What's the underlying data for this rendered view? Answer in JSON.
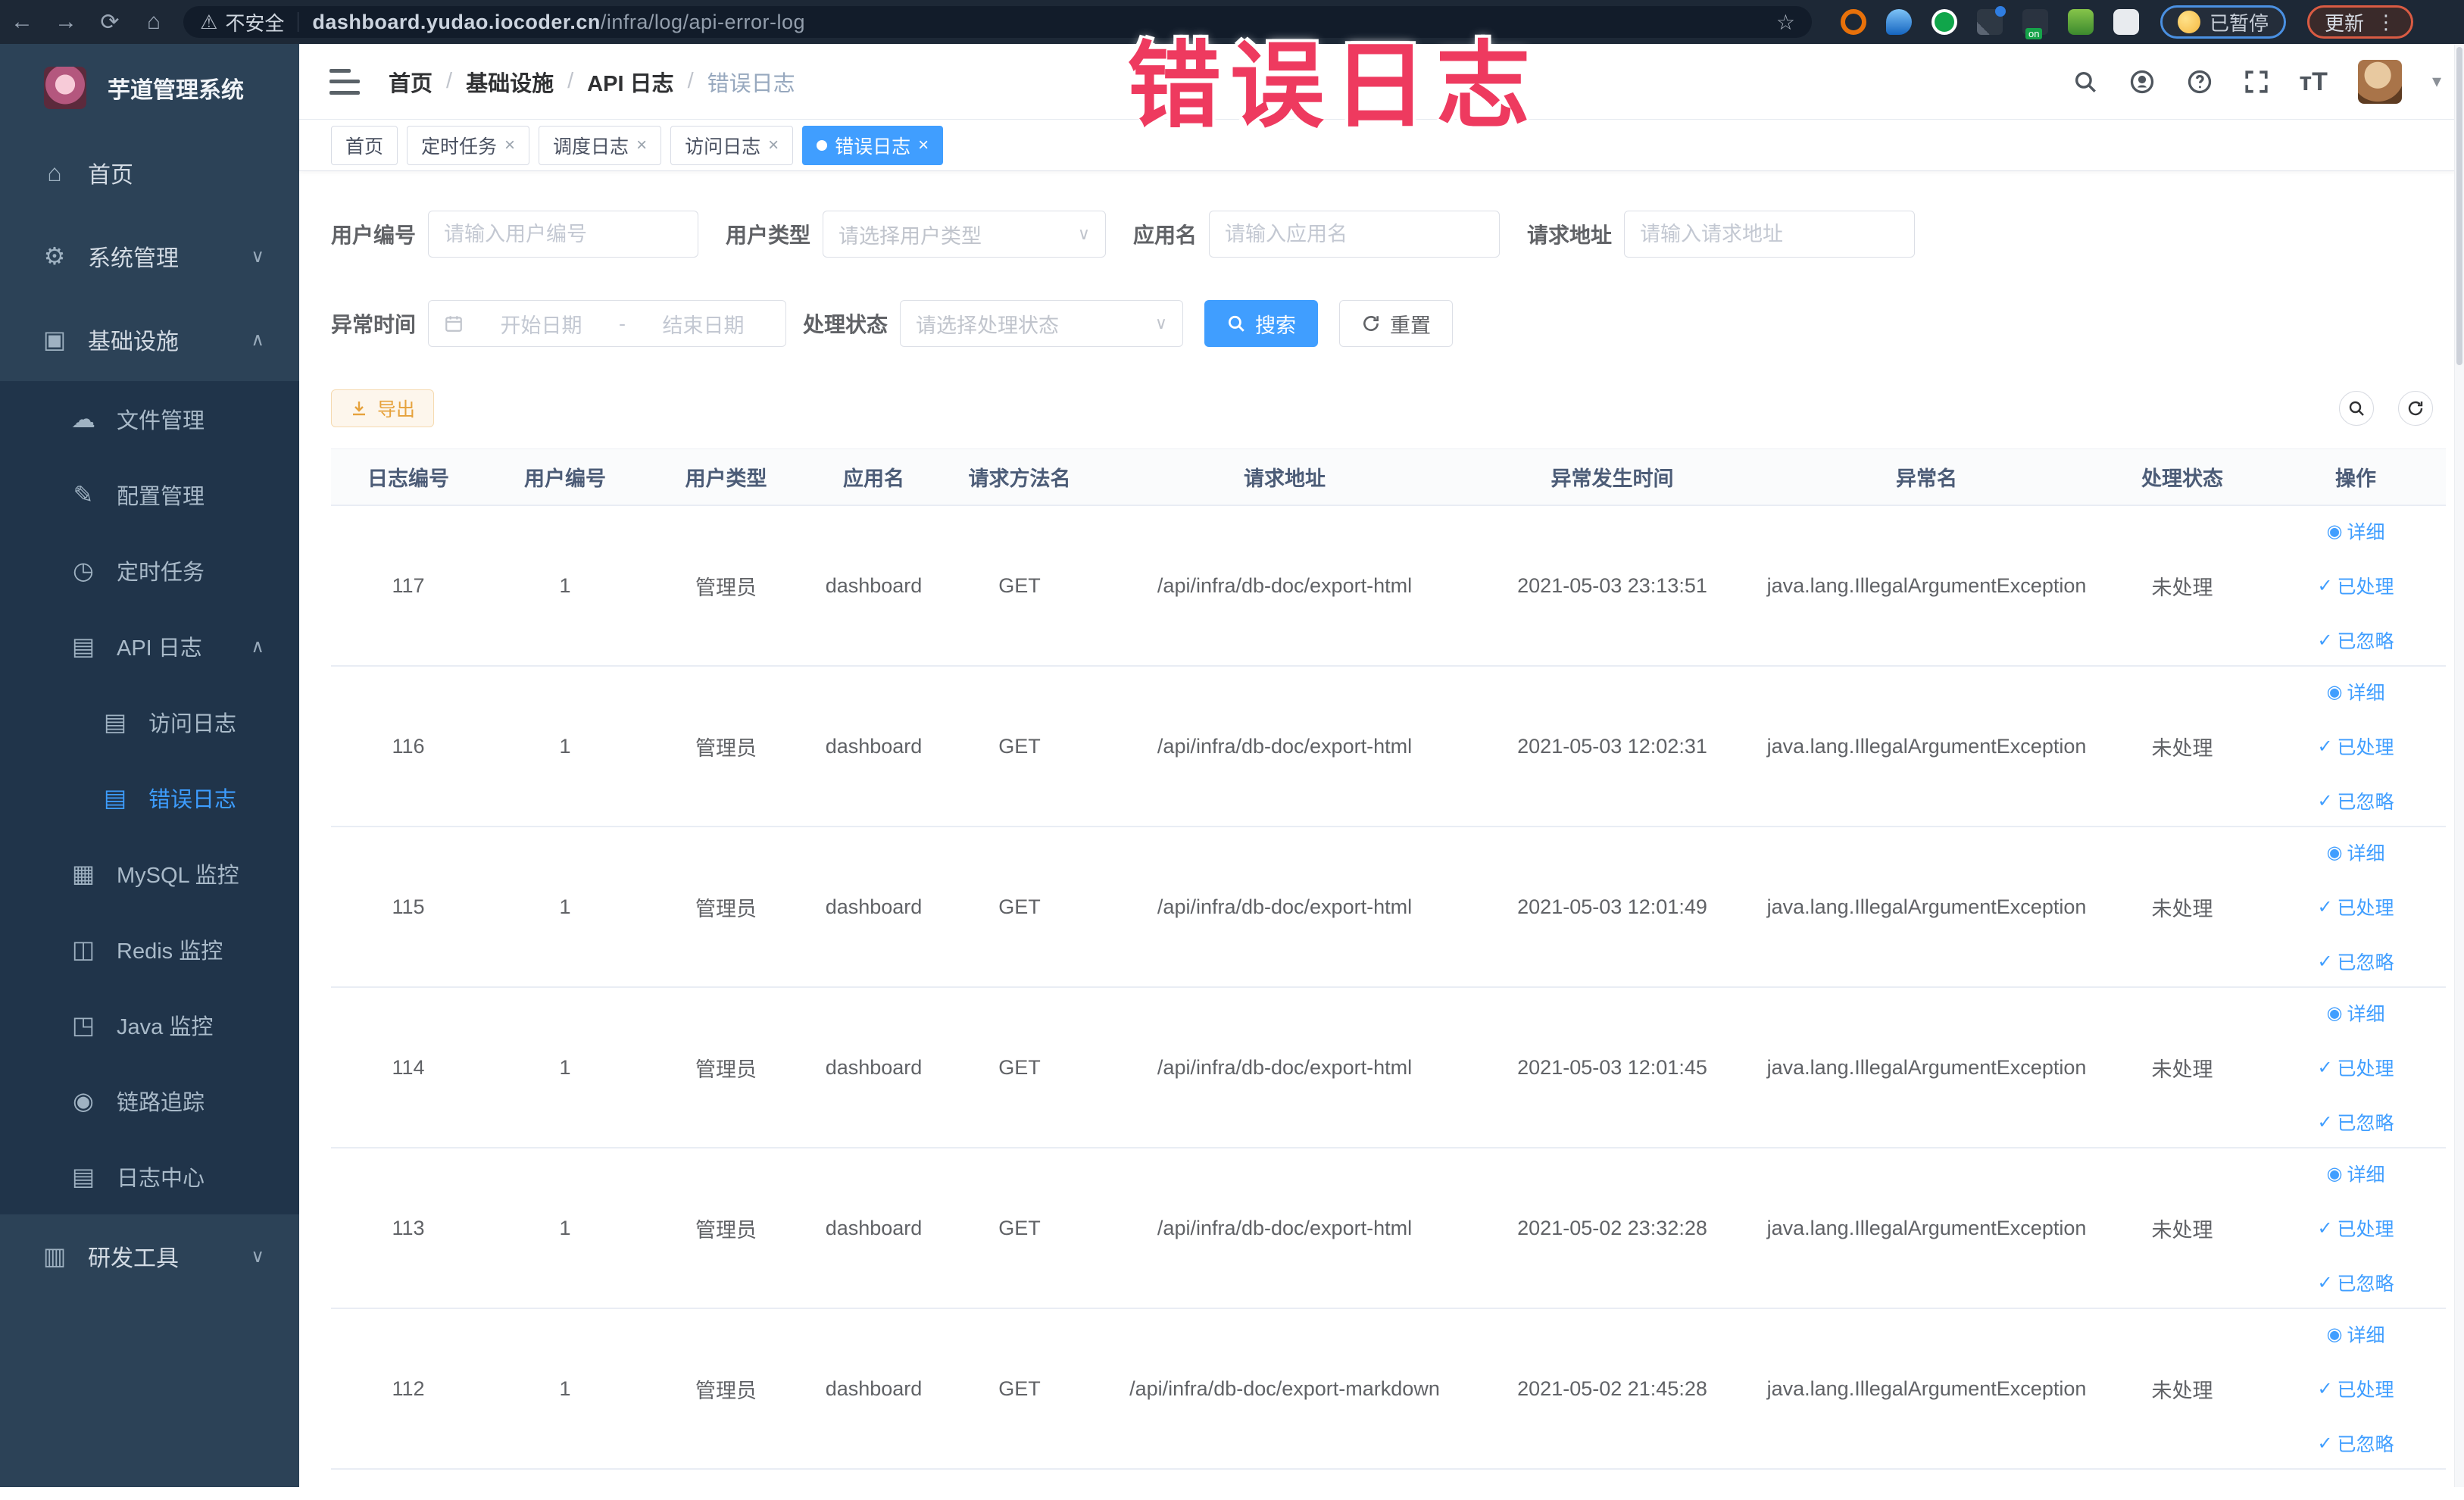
{
  "browser": {
    "security_label": "不安全",
    "url_domain": "dashboard.yudao.iocoder.cn",
    "url_path": "/infra/log/api-error-log",
    "paused_badge": "已暂停",
    "update_button": "更新"
  },
  "overlay": {
    "annotation": "错误日志",
    "color": "#ee3a5f"
  },
  "sidebar": {
    "title": "芋道管理系统",
    "items": [
      {
        "label": "首页",
        "icon": "home-icon",
        "level": 1
      },
      {
        "label": "系统管理",
        "icon": "gear-icon",
        "level": 1,
        "chevron": "down"
      },
      {
        "label": "基础设施",
        "icon": "monitor-icon",
        "level": 1,
        "chevron": "up"
      },
      {
        "label": "文件管理",
        "icon": "file-cloud-icon",
        "level": 2
      },
      {
        "label": "配置管理",
        "icon": "config-edit-icon",
        "level": 2
      },
      {
        "label": "定时任务",
        "icon": "schedule-icon",
        "level": 2
      },
      {
        "label": "API 日志",
        "icon": "api-log-icon",
        "level": 2,
        "chevron": "up"
      },
      {
        "label": "访问日志",
        "icon": "access-log-icon",
        "level": 3
      },
      {
        "label": "错误日志",
        "icon": "error-log-icon",
        "level": 3,
        "active": true
      },
      {
        "label": "MySQL 监控",
        "icon": "mysql-icon",
        "level": 2
      },
      {
        "label": "Redis 监控",
        "icon": "redis-icon",
        "level": 2
      },
      {
        "label": "Java 监控",
        "icon": "java-icon",
        "level": 2
      },
      {
        "label": "链路追踪",
        "icon": "trace-eye-icon",
        "level": 2
      },
      {
        "label": "日志中心",
        "icon": "log-center-icon",
        "level": 2
      },
      {
        "label": "研发工具",
        "icon": "tools-icon",
        "level": 1,
        "chevron": "down"
      }
    ]
  },
  "header": {
    "breadcrumb": [
      "首页",
      "基础设施",
      "API 日志",
      "错误日志"
    ]
  },
  "tags": [
    {
      "label": "首页"
    },
    {
      "label": "定时任务",
      "closable": true
    },
    {
      "label": "调度日志",
      "closable": true
    },
    {
      "label": "访问日志",
      "closable": true
    },
    {
      "label": "错误日志",
      "closable": true,
      "active": true
    }
  ],
  "filters": {
    "user_id": {
      "label": "用户编号",
      "placeholder": "请输入用户编号"
    },
    "user_type": {
      "label": "用户类型",
      "placeholder": "请选择用户类型"
    },
    "app_name": {
      "label": "应用名",
      "placeholder": "请输入应用名"
    },
    "request_url": {
      "label": "请求地址",
      "placeholder": "请输入请求地址"
    },
    "exception_time": {
      "label": "异常时间",
      "start_placeholder": "开始日期",
      "separator": "-",
      "end_placeholder": "结束日期"
    },
    "process_status": {
      "label": "处理状态",
      "placeholder": "请选择处理状态"
    },
    "search_button": "搜索",
    "reset_button": "重置"
  },
  "toolbar": {
    "export_button": "导出"
  },
  "table": {
    "columns": [
      "日志编号",
      "用户编号",
      "用户类型",
      "应用名",
      "请求方法名",
      "请求地址",
      "异常发生时间",
      "异常名",
      "处理状态",
      "操作"
    ],
    "actions": [
      "详细",
      "已处理",
      "已忽略"
    ],
    "rows": [
      {
        "id": "117",
        "user_id": "1",
        "user_type": "管理员",
        "app": "dashboard",
        "method": "GET",
        "url": "/api/infra/db-doc/export-html",
        "time": "2021-05-03 23:13:51",
        "exception": "java.lang.IllegalArgumentException",
        "status": "未处理"
      },
      {
        "id": "116",
        "user_id": "1",
        "user_type": "管理员",
        "app": "dashboard",
        "method": "GET",
        "url": "/api/infra/db-doc/export-html",
        "time": "2021-05-03 12:02:31",
        "exception": "java.lang.IllegalArgumentException",
        "status": "未处理"
      },
      {
        "id": "115",
        "user_id": "1",
        "user_type": "管理员",
        "app": "dashboard",
        "method": "GET",
        "url": "/api/infra/db-doc/export-html",
        "time": "2021-05-03 12:01:49",
        "exception": "java.lang.IllegalArgumentException",
        "status": "未处理"
      },
      {
        "id": "114",
        "user_id": "1",
        "user_type": "管理员",
        "app": "dashboard",
        "method": "GET",
        "url": "/api/infra/db-doc/export-html",
        "time": "2021-05-03 12:01:45",
        "exception": "java.lang.IllegalArgumentException",
        "status": "未处理"
      },
      {
        "id": "113",
        "user_id": "1",
        "user_type": "管理员",
        "app": "dashboard",
        "method": "GET",
        "url": "/api/infra/db-doc/export-html",
        "time": "2021-05-02 23:32:28",
        "exception": "java.lang.IllegalArgumentException",
        "status": "未处理"
      },
      {
        "id": "112",
        "user_id": "1",
        "user_type": "管理员",
        "app": "dashboard",
        "method": "GET",
        "url": "/api/infra/db-doc/export-markdown",
        "time": "2021-05-02 21:45:28",
        "exception": "java.lang.IllegalArgumentException",
        "status": "未处理"
      }
    ]
  },
  "colors": {
    "primary": "#409eff",
    "annotation": "#ee3a5f",
    "warning": "#e6a23c",
    "sidebar_bg": "#2c4257",
    "submenu_bg": "#20344a",
    "active_tab_bg": "#409eff"
  }
}
